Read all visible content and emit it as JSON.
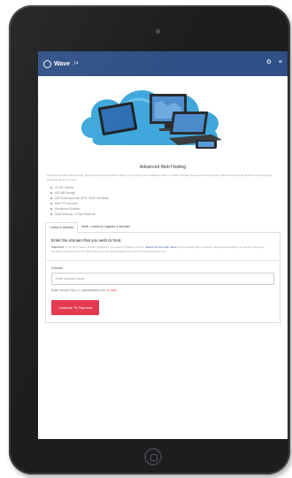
{
  "app": {
    "logo_text": "Wave",
    "logo_sup": "24",
    "settings_icon": "gear-icon",
    "menu_icon": "menu-icon"
  },
  "hero": {
    "title": "Advanced Web Hosting"
  },
  "intro": "At Wavenetworks Web Hosting, Enterprise-level performance allows you to grow web confidence with our 100% in-house developed control system allows us to provide features the integrated professional as you need.",
  "features": [
    "20 GB Transfer",
    "500 MB Storage",
    "500 Email Accounts (POP, IMAP, WebMail)",
    "500 FTP Accounts",
    "Wordpress Enabled",
    "Daily Backups - 3 Day Historical"
  ],
  "tabs": [
    {
      "label": "I have a domain"
    },
    {
      "label": "Wait, I need to register a domain"
    }
  ],
  "panel": {
    "title": "Enter the domain that you wish to host.",
    "notice_bold": "Important:",
    "notice_text_1": "If you don't have a domain registered, you need to register one first.",
    "notice_link": "Search for a domain name.",
    "notice_text_2": "If you already have a domain registered elsewhere you need to point your domains nameservers to our DNS servers at ns1.wavenetworks.com and ns2.wavenetworks.com",
    "domain_label": "Domain",
    "domain_placeholder": "Enter Domain Name",
    "hint_text": "Enter Domain Only, i.e, wavenetworks.com,",
    "hint_warn": "no www.",
    "continue_label": "Continue To Payment"
  },
  "colors": {
    "appbar": "#2f4f86",
    "accent": "#e33a52",
    "cloud": "#3fa7dc"
  }
}
